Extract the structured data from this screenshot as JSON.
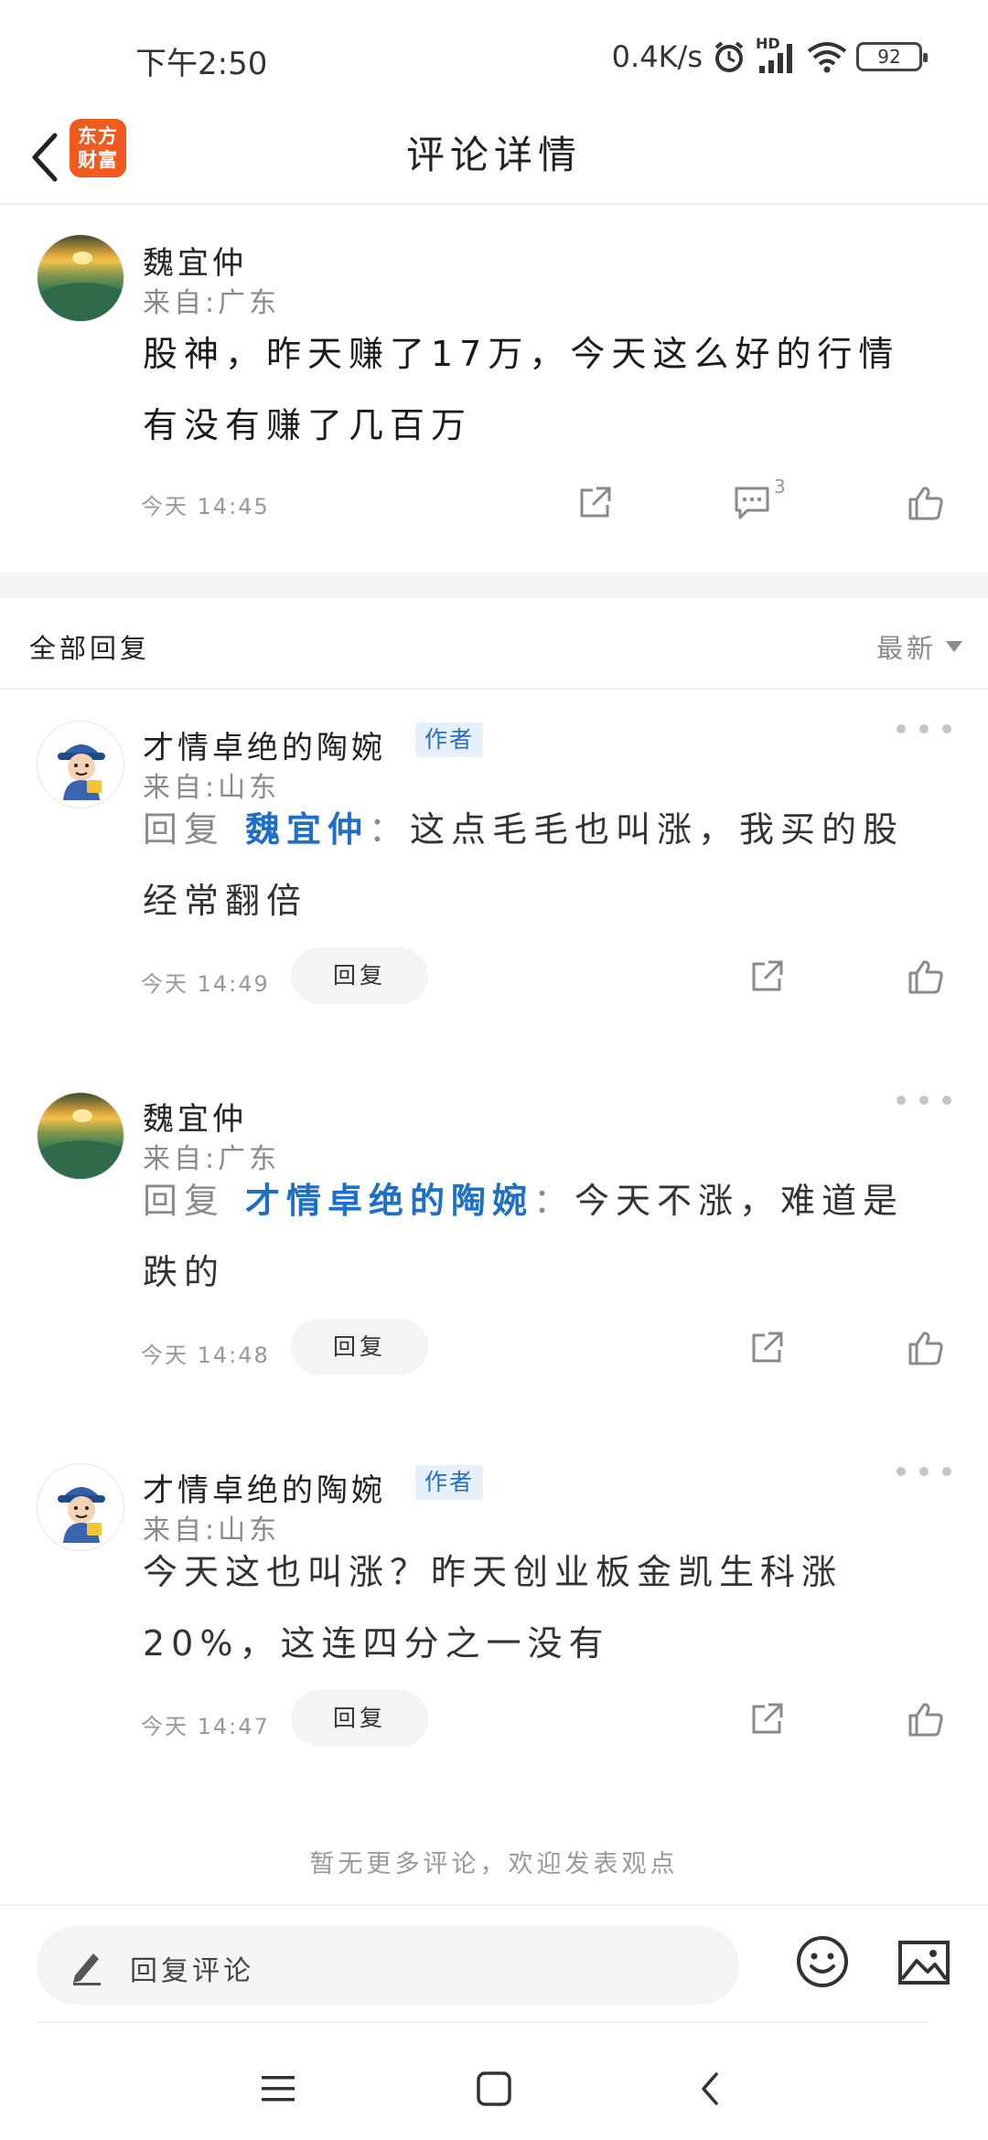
{
  "status_bar": {
    "time": "下午2:50",
    "network_speed": "0.4K/s",
    "hd_label": "HD",
    "battery": "92",
    "icons": [
      "alarm-icon",
      "signal-icon",
      "wifi-icon",
      "battery-icon"
    ]
  },
  "header": {
    "title": "评论详情",
    "logo_line1": "东方",
    "logo_line2": "财富",
    "logo_color": "#f05a1e"
  },
  "main_comment": {
    "username": "魏宜仲",
    "origin": "来自:广东",
    "text_line1": "股神，昨天赚了17万，今天这么好的行情",
    "text_line2": "有没有赚了几百万",
    "time": "今天  14:45",
    "comment_count": "3"
  },
  "replies_header": {
    "title": "全部回复",
    "sort": "最新"
  },
  "replies": [
    {
      "username": "才情卓绝的陶婉",
      "badge": "作者",
      "origin": "来自:山东",
      "prefix": "回复",
      "mention": "魏宜仲",
      "separator": "：",
      "text_line1_rest": "这点毛毛也叫涨，我买的股",
      "text_line2": "经常翻倍",
      "time": "今天  14:49",
      "reply_label": "回复"
    },
    {
      "username": "魏宜仲",
      "origin": "来自:广东",
      "prefix": "回复",
      "mention": "才情卓绝的陶婉",
      "separator": "：",
      "text_line1_rest": "今天不涨，难道是",
      "text_line2": "跌的",
      "time": "今天  14:48",
      "reply_label": "回复"
    },
    {
      "username": "才情卓绝的陶婉",
      "badge": "作者",
      "origin": "来自:山东",
      "text_line1": "今天这也叫涨？昨天创业板金凯生科涨",
      "text_line2": "20%，这连四分之一没有",
      "time": "今天  14:47",
      "reply_label": "回复"
    }
  ],
  "footer_note": "暂无更多评论，欢迎发表观点",
  "input": {
    "placeholder": "回复评论"
  },
  "colors": {
    "accent_blue": "#1d6fc8",
    "badge_bg": "#e6f0fa",
    "muted": "#8a8a8a"
  }
}
